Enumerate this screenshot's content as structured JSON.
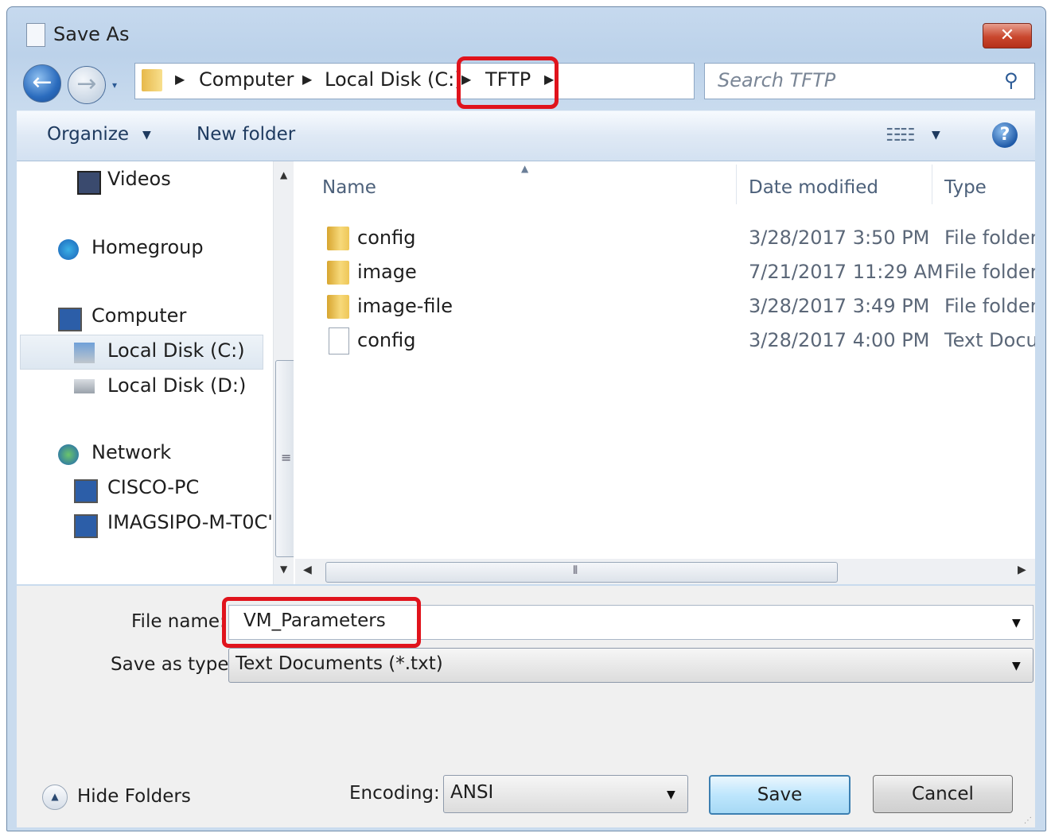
{
  "window": {
    "title": "Save As",
    "close_label": "✕"
  },
  "nav": {
    "back_glyph": "←",
    "forward_glyph": "→",
    "recent_glyph": "▾"
  },
  "address": {
    "crumbs": [
      "Computer",
      "Local Disk (C:)",
      "TFTP"
    ],
    "refresh_glyph": "↻"
  },
  "search": {
    "placeholder": "Search TFTP"
  },
  "toolbar": {
    "organize": "Organize",
    "new_folder": "New folder",
    "help": "?"
  },
  "sidebar": {
    "items": [
      {
        "label": "Videos",
        "icon": "video-icon"
      },
      {
        "label": "Homegroup",
        "icon": "homegroup-icon"
      },
      {
        "label": "Computer",
        "icon": "computer-icon"
      },
      {
        "label": "Local Disk (C:)",
        "icon": "drive-icon",
        "selected": true
      },
      {
        "label": "Local Disk (D:)",
        "icon": "drive-icon"
      },
      {
        "label": "Network",
        "icon": "network-icon"
      },
      {
        "label": "CISCO-PC",
        "icon": "computer-icon"
      },
      {
        "label": "IMAGSIPO-M-T0C'",
        "icon": "computer-icon"
      }
    ]
  },
  "files": {
    "columns": [
      "Name",
      "Date modified",
      "Type"
    ],
    "rows": [
      {
        "name": "config",
        "date": "3/28/2017 3:50 PM",
        "type": "File folder",
        "icon": "folder-icon"
      },
      {
        "name": "image",
        "date": "7/21/2017 11:29 AM",
        "type": "File folder",
        "icon": "folder-icon"
      },
      {
        "name": "image-file",
        "date": "3/28/2017 3:49 PM",
        "type": "File folder",
        "icon": "folder-icon"
      },
      {
        "name": "config",
        "date": "3/28/2017 4:00 PM",
        "type": "Text Docur",
        "icon": "text-document-icon"
      }
    ]
  },
  "form": {
    "file_name_label": "File name:",
    "file_name_value": "VM_Parameters",
    "save_as_type_label": "Save as type:",
    "save_as_type_value": "Text Documents (*.txt)",
    "encoding_label": "Encoding:",
    "encoding_value": "ANSI",
    "hide_folders": "Hide Folders",
    "save": "Save",
    "cancel": "Cancel"
  },
  "colors": {
    "highlight": "#e0131c",
    "accent": "#3c7fb1"
  }
}
